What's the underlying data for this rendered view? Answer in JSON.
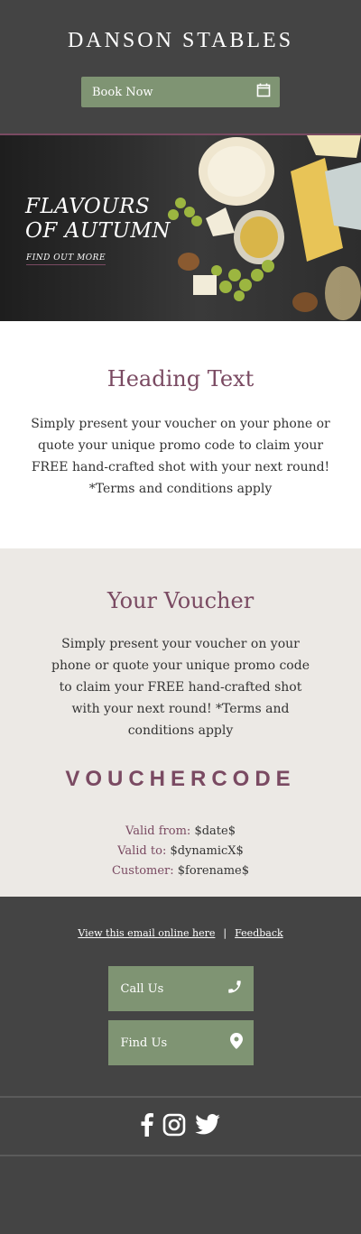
{
  "header": {
    "brand": "DANSON STABLES",
    "book_label": "Book Now"
  },
  "hero": {
    "title_line1": "FLAVOURS",
    "title_line2": "OF AUTUMN",
    "link": "FIND OUT MORE"
  },
  "intro": {
    "heading": "Heading Text",
    "body": "Simply present your voucher on your phone or quote your unique promo code to claim your FREE hand-crafted shot with your next round! *Terms and conditions apply"
  },
  "voucher": {
    "heading": "Your Voucher",
    "body": "Simply present your voucher on your phone or quote your unique promo code to claim your FREE hand-crafted shot with your next round! *Terms and conditions apply",
    "code": "VOUCHERCODE",
    "valid_from_label": "Valid from:",
    "valid_from_value": "$date$",
    "valid_to_label": "Valid to:",
    "valid_to_value": "$dynamicX$",
    "customer_label": "Customer:",
    "customer_value": "$forename$"
  },
  "footer": {
    "view_online": "View this email online here",
    "separator": "|",
    "feedback": "Feedback",
    "call_label": "Call Us",
    "find_label": "Find Us"
  },
  "colors": {
    "accent": "#7a4a62",
    "button": "#7f9473",
    "dark": "#444444",
    "voucher_bg": "#ece9e5"
  },
  "icons": [
    "calendar-icon",
    "phone-icon",
    "location-icon",
    "facebook-icon",
    "instagram-icon",
    "twitter-icon"
  ]
}
